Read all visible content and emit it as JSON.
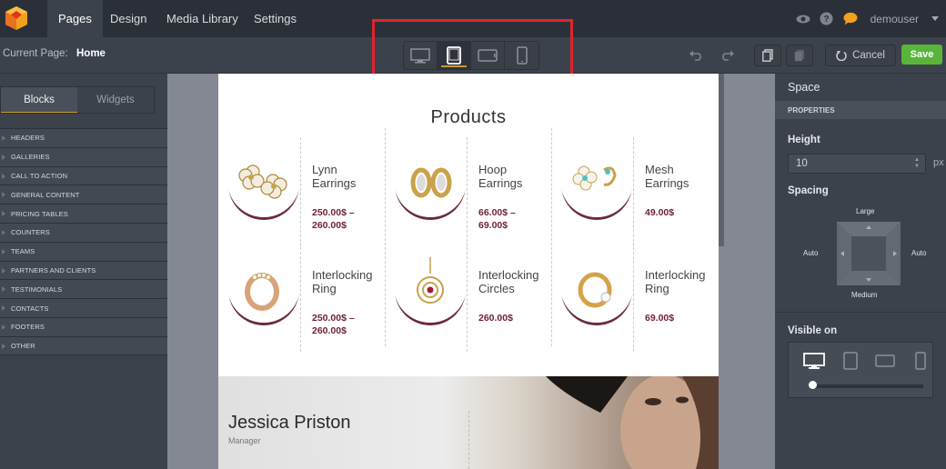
{
  "topbar": {
    "nav": [
      "Pages",
      "Design",
      "Media Library",
      "Settings"
    ],
    "user": "demouser"
  },
  "subbar": {
    "current_page_label": "Current Page:",
    "current_page_value": "Home",
    "cancel_label": "Cancel",
    "save_label": "Save"
  },
  "left": {
    "tabs": [
      "Blocks",
      "Widgets"
    ],
    "blocks": [
      "HEADERS",
      "GALLERIES",
      "CALL TO ACTION",
      "GENERAL CONTENT",
      "PRICING TABLES",
      "COUNTERS",
      "TEAMS",
      "PARTNERS AND CLIENTS",
      "TESTIMONIALS",
      "CONTACTS",
      "FOOTERS",
      "OTHER"
    ]
  },
  "preview": {
    "title": "Products",
    "products": [
      {
        "name_1": "Lynn",
        "name_2": "Earrings",
        "price_1": "250.00$ –",
        "price_2": "260.00$"
      },
      {
        "name_1": "Hoop",
        "name_2": "Earrings",
        "price_1": "66.00$ –",
        "price_2": "69.00$"
      },
      {
        "name_1": "Mesh",
        "name_2": "Earrings",
        "price_1": "49.00$",
        "price_2": ""
      },
      {
        "name_1": "Interlocking",
        "name_2": "Ring",
        "price_1": "250.00$ –",
        "price_2": "260.00$"
      },
      {
        "name_1": "Interlocking",
        "name_2": "Circles",
        "price_1": "260.00$",
        "price_2": ""
      },
      {
        "name_1": "Interlocking",
        "name_2": "Ring",
        "price_1": "69.00$",
        "price_2": ""
      }
    ],
    "hero": {
      "name": "Jessica Priston",
      "role": "Manager"
    }
  },
  "right": {
    "title": "Space",
    "section": "PROPERTIES",
    "height_label": "Height",
    "height_value": "10",
    "height_unit": "px",
    "spacing_label": "Spacing",
    "spacing_top": "Large",
    "spacing_bottom": "Medium",
    "spacing_left": "Auto",
    "spacing_right": "Auto",
    "visible_label": "Visible on"
  },
  "colors": {
    "accent": "#c89a2e",
    "save": "#59b53a",
    "highlight": "#e0242a",
    "price": "#6e1f33"
  },
  "icons": [
    "logo-icon",
    "eye-icon",
    "help-icon",
    "chat-icon",
    "desktop-icon",
    "tablet-icon",
    "tablet-landscape-icon",
    "mobile-icon",
    "undo-icon",
    "redo-icon",
    "copy-icon",
    "delete-icon",
    "cancel-icon"
  ]
}
